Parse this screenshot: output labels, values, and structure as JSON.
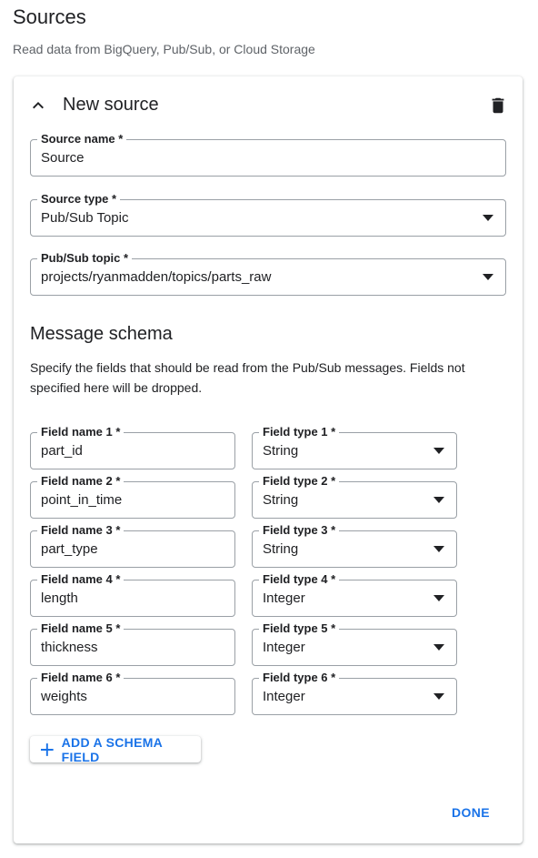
{
  "page": {
    "title": "Sources",
    "subtitle": "Read data from BigQuery, Pub/Sub, or Cloud Storage"
  },
  "card": {
    "title": "New source",
    "source_name": {
      "label": "Source name *",
      "value": "Source"
    },
    "source_type": {
      "label": "Source type *",
      "value": "Pub/Sub Topic"
    },
    "pubsub_topic": {
      "label": "Pub/Sub topic *",
      "value": "projects/ryanmadden/topics/parts_raw"
    }
  },
  "schema": {
    "title": "Message schema",
    "description": "Specify the fields that should be read from the Pub/Sub messages. Fields not specified here will be dropped.",
    "fields": [
      {
        "name_label": "Field name 1 *",
        "name": "part_id",
        "type_label": "Field type 1 *",
        "type": "String"
      },
      {
        "name_label": "Field name 2 *",
        "name": "point_in_time",
        "type_label": "Field type 2 *",
        "type": "String"
      },
      {
        "name_label": "Field name 3 *",
        "name": "part_type",
        "type_label": "Field type 3 *",
        "type": "String"
      },
      {
        "name_label": "Field name 4 *",
        "name": "length",
        "type_label": "Field type 4 *",
        "type": "Integer"
      },
      {
        "name_label": "Field name 5 *",
        "name": "thickness",
        "type_label": "Field type 5 *",
        "type": "Integer"
      },
      {
        "name_label": "Field name 6 *",
        "name": "weights",
        "type_label": "Field type 6 *",
        "type": "Integer"
      }
    ],
    "add_label": "ADD A SCHEMA FIELD"
  },
  "actions": {
    "done_label": "DONE"
  },
  "icons": {
    "collapse": "chevron-up-icon",
    "delete": "trash-icon",
    "dropdown": "arrow-drop-down-icon",
    "add": "plus-icon"
  },
  "colors": {
    "accent": "#1a73e8",
    "text": "#202124",
    "muted": "#5f6368",
    "border": "#9aa0a6"
  }
}
